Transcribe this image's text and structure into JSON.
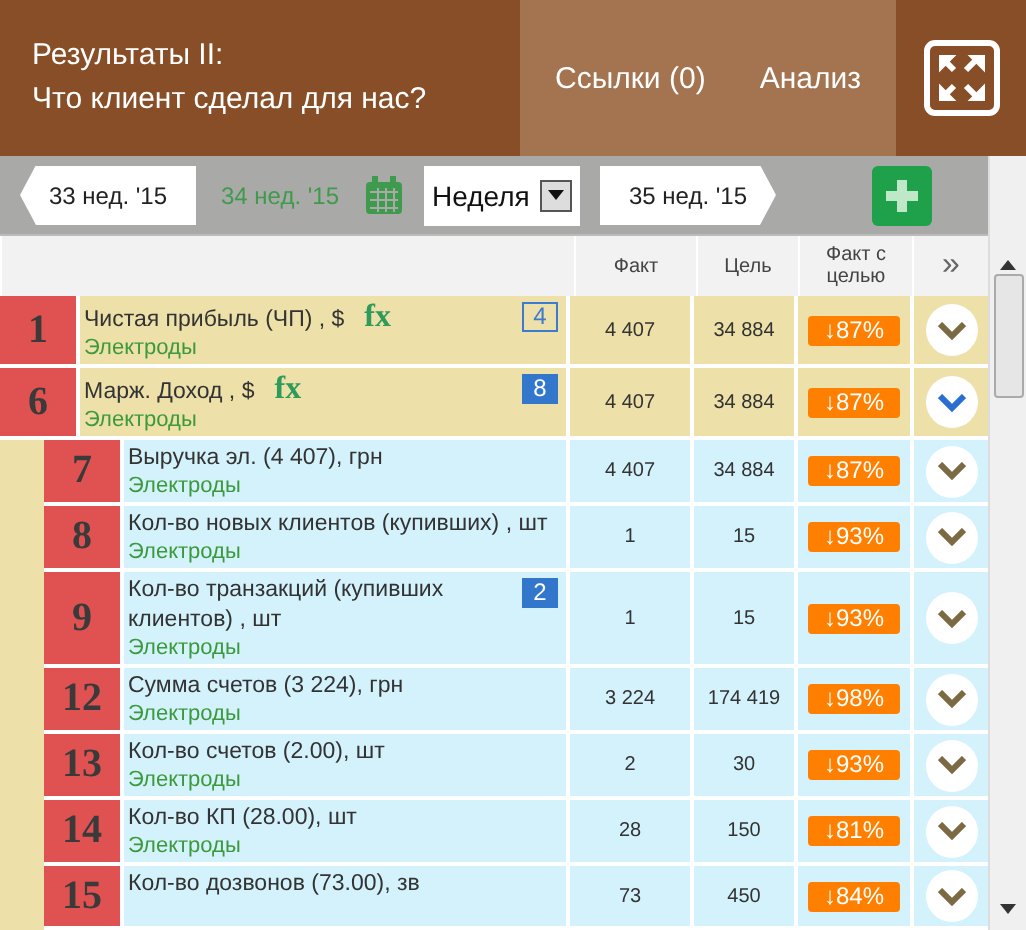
{
  "header": {
    "title_lines": [
      "Результаты II:",
      "Что клиент сделал для нас?"
    ],
    "links": [
      "Ссылки (0)",
      "Анализ"
    ]
  },
  "toolbar": {
    "prev": "33 нед. '15",
    "current": "34 нед. '15",
    "period": "Неделя",
    "next": "35 нед. '15"
  },
  "table": {
    "columns": [
      "Факт",
      "Цель",
      "Факт с целью"
    ],
    "more": "»",
    "rows": [
      {
        "num": "1",
        "title": "Чистая прибыль (ЧП) , $",
        "fx": "fx",
        "group": "Электроды",
        "badge": {
          "text": "4",
          "kind": "outline"
        },
        "fact": "4 407",
        "target": "34 884",
        "percent": "↓87%",
        "expanded": false
      },
      {
        "num": "6",
        "title": "Марж. Доход , $",
        "fx": "fx",
        "group": "Электроды",
        "badge": {
          "text": "8",
          "kind": "filled"
        },
        "fact": "4 407",
        "target": "34 884",
        "percent": "↓87%",
        "expanded": true,
        "children": [
          {
            "num": "7",
            "title": "Выручка эл. (4 407), грн",
            "group": "Электроды",
            "fact": "4 407",
            "target": "34 884",
            "percent": "↓87%",
            "expanded": false
          },
          {
            "num": "8",
            "title": "Кол-во новых клиентов (купивших) , шт",
            "group": "Электроды",
            "fact": "1",
            "target": "15",
            "percent": "↓93%",
            "expanded": false
          },
          {
            "num": "9",
            "title": "Кол-во транзакций (купивших клиентов) , шт",
            "group": "Электроды",
            "badge": {
              "text": "2",
              "kind": "filled"
            },
            "fact": "1",
            "target": "15",
            "percent": "↓93%",
            "expanded": false
          },
          {
            "num": "12",
            "title": "Сумма счетов (3 224), грн",
            "group": "Электроды",
            "fact": "3 224",
            "target": "174 419",
            "percent": "↓98%",
            "expanded": false
          },
          {
            "num": "13",
            "title": "Кол-во счетов (2.00), шт",
            "group": "Электроды",
            "fact": "2",
            "target": "30",
            "percent": "↓93%",
            "expanded": false
          },
          {
            "num": "14",
            "title": "Кол-во КП (28.00), шт",
            "group": "Электроды",
            "fact": "28",
            "target": "150",
            "percent": "↓81%",
            "expanded": false
          },
          {
            "num": "15",
            "title": "Кол-во дозвонов (73.00), зв",
            "fact": "73",
            "target": "450",
            "percent": "↓84%",
            "expanded": false
          }
        ]
      }
    ]
  }
}
